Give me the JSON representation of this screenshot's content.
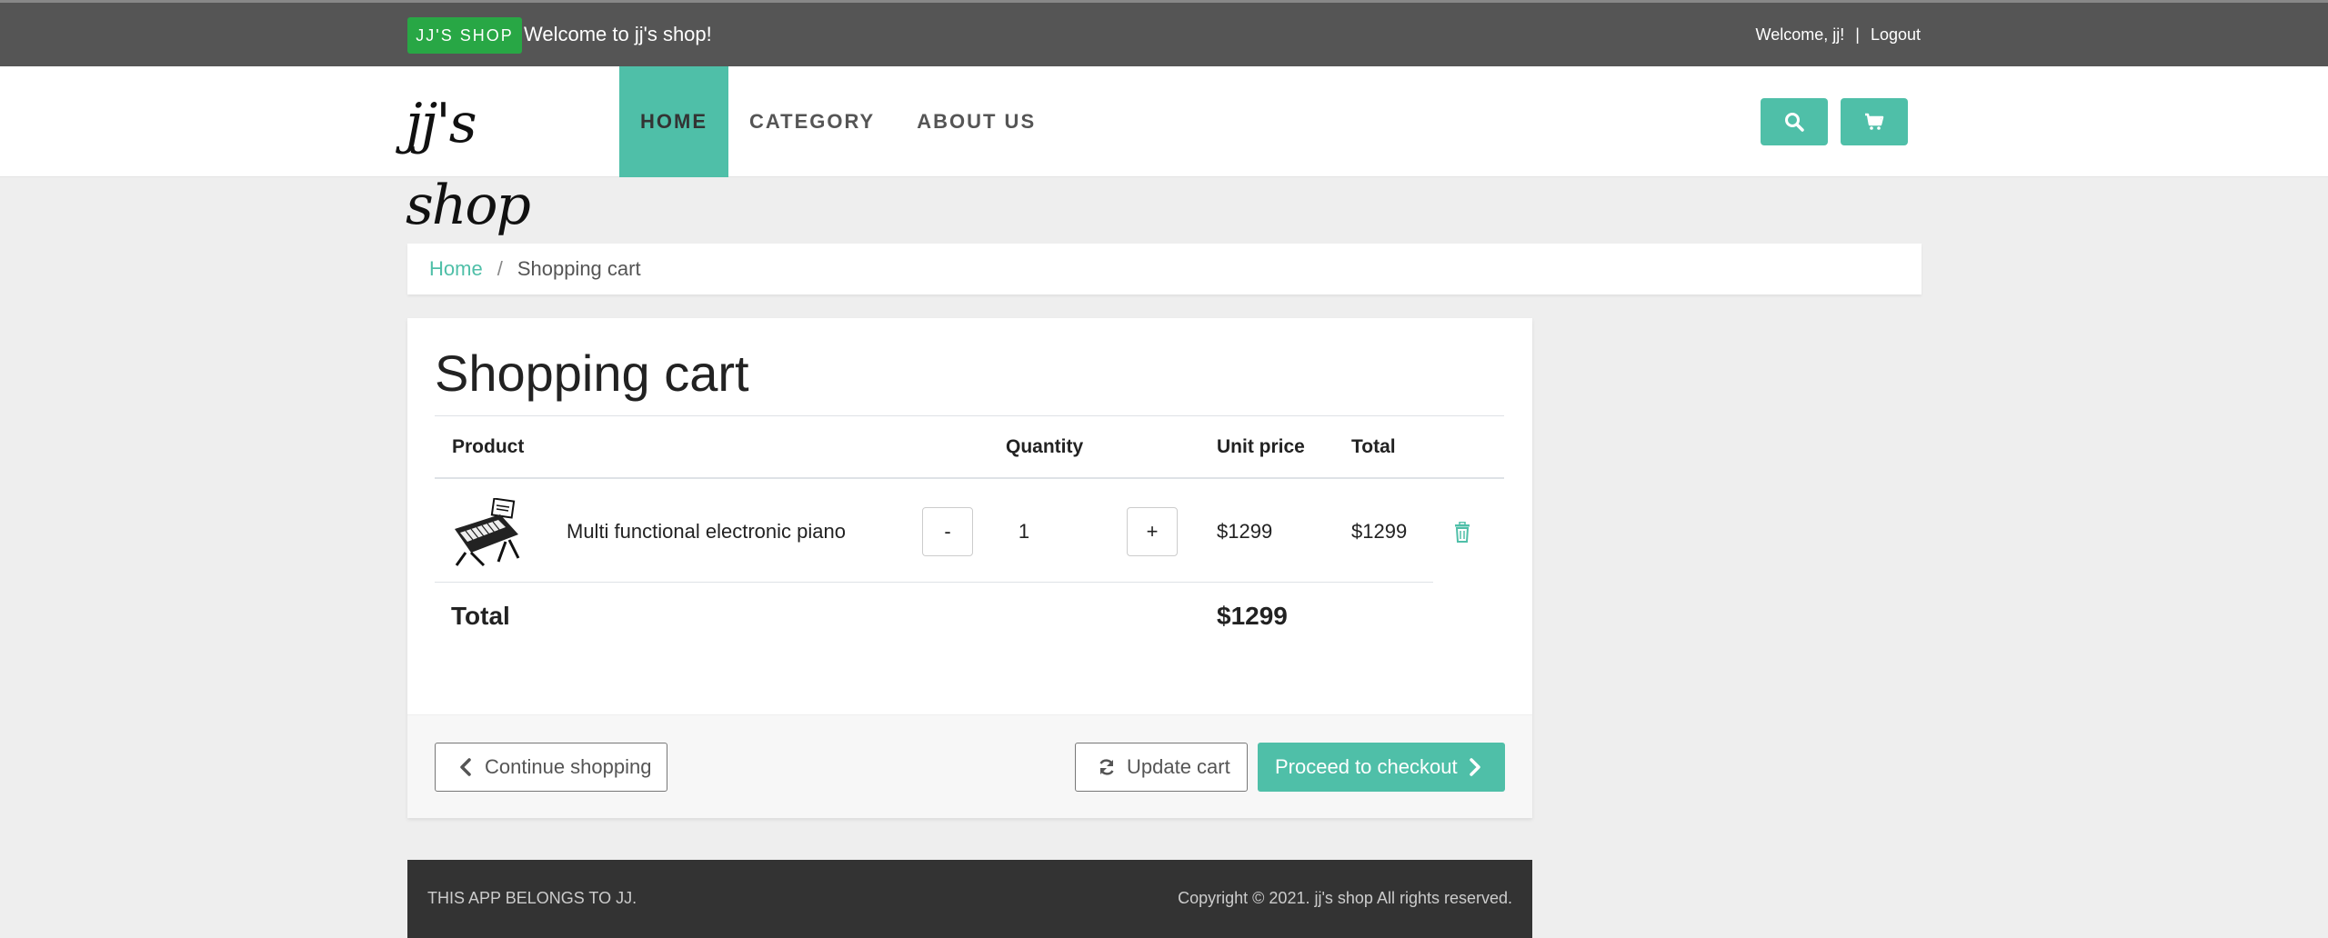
{
  "topbar": {
    "badge": "JJ'S SHOP",
    "welcome": "Welcome to jj's shop!",
    "user_greeting": "Welcome, jj!",
    "separator": "|",
    "logout": "Logout"
  },
  "navbar": {
    "logo_text": "jj's shop",
    "items": [
      {
        "label": "HOME"
      },
      {
        "label": "CATEGORY"
      },
      {
        "label": "ABOUT US"
      }
    ],
    "search_icon": "search-icon",
    "cart_icon": "cart-icon"
  },
  "breadcrumb": {
    "home": "Home",
    "divider": "/",
    "current": "Shopping cart"
  },
  "cart": {
    "title": "Shopping cart",
    "headers": {
      "product": "Product",
      "quantity": "Quantity",
      "unit_price": "Unit price",
      "total": "Total"
    },
    "items": [
      {
        "name": "Multi functional electronic piano",
        "minus": "-",
        "quantity": "1",
        "plus": "+",
        "unit_price": "$1299",
        "total": "$1299",
        "image": "piano-keyboard-image",
        "remove_icon": "trash-icon"
      }
    ],
    "total_label": "Total",
    "total_value": "$1299",
    "buttons": {
      "continue": "Continue shopping",
      "update": "Update cart",
      "checkout": "Proceed to checkout"
    }
  },
  "footer": {
    "left": "THIS APP BELONGS TO JJ.",
    "right": "Copyright © 2021. jj's shop All rights reserved."
  },
  "colors": {
    "accent": "#4fbfa8",
    "badge": "#28a745",
    "topbar": "#555555",
    "footer": "#333333"
  }
}
